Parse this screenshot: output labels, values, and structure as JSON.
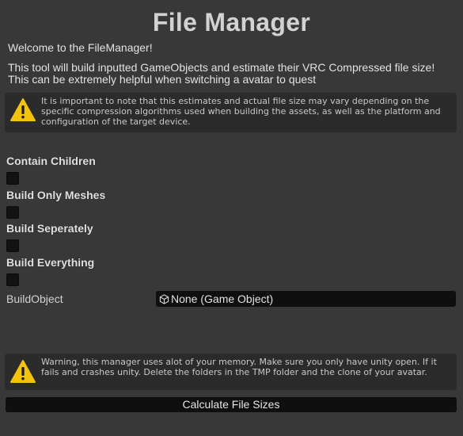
{
  "header": {
    "title": "File Manager"
  },
  "intro": {
    "welcome": "Welcome to the FileManager!",
    "description": "This tool will build inputted GameObjects and estimate their VRC Compressed file size! This can be extremely helpful when switching a avatar to quest"
  },
  "info_box": {
    "icon": "warning-icon",
    "text": "It is important to note that this estimates and actual file size may vary depending on the specific compression algorithms used when building the assets, as well as the platform and configuration of the target device."
  },
  "options": [
    {
      "label": "Contain Children",
      "checked": false
    },
    {
      "label": "Build Only Meshes",
      "checked": false
    },
    {
      "label": "Build Seperately",
      "checked": false
    },
    {
      "label": "Build Everything",
      "checked": false
    }
  ],
  "build_object": {
    "label": "BuildObject",
    "value": "None (Game Object)",
    "icon": "cube-icon"
  },
  "warning_box": {
    "icon": "warning-icon",
    "text": "Warning, this manager uses alot of your memory. Make sure you only have unity open. If it fails and crashes unity. Delete the folders in the TMP folder and the clone of your avatar."
  },
  "actions": {
    "calculate_label": "Calculate File Sizes"
  },
  "colors": {
    "background": "#383838",
    "help_box": "#2b2b2b",
    "field": "#0f0f0f",
    "warning_yellow": "#f3c20c"
  }
}
